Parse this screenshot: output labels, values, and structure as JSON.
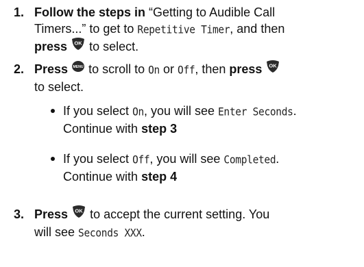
{
  "steps": [
    {
      "number": "1.",
      "line1_bold": "Follow the steps in",
      "line1_text": "“Getting to Audible Call",
      "line2_text": "Timers...” to get to",
      "line2_lcd": "Repetitive Timer",
      "line2_text_end": ", and then",
      "line3_bold": "press",
      "line3_icon": "ok-key-icon",
      "line3_text": "to select."
    },
    {
      "number": "2.",
      "line1_bold": "Press",
      "line1_icon": "menu-key-icon",
      "line1_text": "to scroll to",
      "line1_lcd_on": "On",
      "line1_or": "or",
      "line1_lcd_off": "Off",
      "line1_then": ", then",
      "line1_bold2": "press",
      "line1_icon2": "ok-key-icon",
      "line2_text": "to select."
    },
    {
      "number": "3.",
      "line1_bold": "Press",
      "line1_icon": "ok-key-icon",
      "line1_text": "to accept the current setting. You",
      "line2_text": "will see",
      "line2_lcd": "Seconds XXX",
      "line2_end": "."
    }
  ],
  "bullets": [
    {
      "prefix": "If you select",
      "lcd1": "On",
      "mid": ", you will see",
      "lcd2": "Enter Seconds",
      "end": ".",
      "cont": "Continue with",
      "step": "step 3"
    },
    {
      "prefix": "If you select",
      "lcd1": "Off",
      "mid": ", you will see",
      "lcd2": "Completed",
      "end": ".",
      "cont": "Continue with",
      "step": "step 4"
    }
  ],
  "colors": {
    "text": "#111111",
    "key_fill": "#2b2b2b",
    "key_label": "#ffffff"
  },
  "key_labels": {
    "ok": "OK",
    "menu": "MENU"
  }
}
